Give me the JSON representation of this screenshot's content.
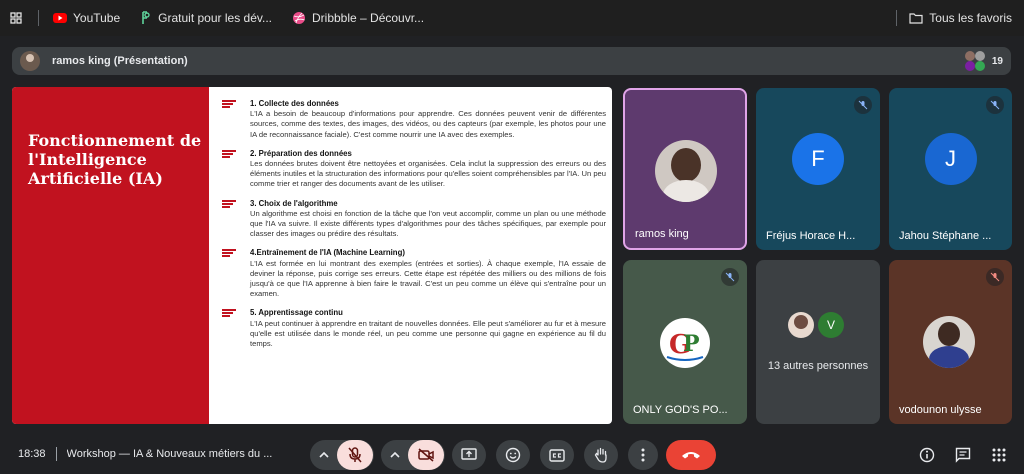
{
  "bookmarks": {
    "items": [
      {
        "label": "YouTube",
        "icon": "youtube-icon"
      },
      {
        "label": "Gratuit pour les dév...",
        "icon": "figma-icon"
      },
      {
        "label": "Dribbble – Découvr...",
        "icon": "dribbble-icon"
      }
    ],
    "all_favorites": "Tous les favoris"
  },
  "presentation_bar": {
    "label": "ramos king (Présentation)",
    "participant_count": "19"
  },
  "slide": {
    "title": "Fonctionnement de l'Intelligence Artificielle (IA)",
    "sections": [
      {
        "title": "1. Collecte des données",
        "body": "L'IA a besoin de beaucoup d'informations pour apprendre. Ces données peuvent venir de différentes sources, comme des textes, des images, des vidéos, ou des capteurs (par exemple, les photos pour une IA de reconnaissance faciale). C'est comme nourrir une IA avec des exemples."
      },
      {
        "title": "2. Préparation des données",
        "body": "Les données brutes doivent être nettoyées et organisées. Cela inclut la suppression des erreurs ou des éléments inutiles et la structuration des informations pour qu'elles soient compréhensibles par l'IA. Un peu comme trier et ranger des documents avant de les utiliser."
      },
      {
        "title": "3. Choix de l'algorithme",
        "body": "Un algorithme est choisi en fonction de la tâche que l'on veut accomplir, comme un plan ou une méthode que l'IA va suivre. Il existe différents types d'algorithmes pour des tâches spécifiques, par exemple pour classer des images ou prédire des résultats."
      },
      {
        "title": "4.Entraînement de l'IA (Machine Learning)",
        "body": "L'IA est formée en lui montrant des exemples (entrées et sorties). À chaque exemple, l'IA essaie de deviner la réponse, puis corrige ses erreurs. Cette étape est répétée des milliers ou des millions de fois jusqu'à ce que l'IA apprenne à bien faire le travail. C'est un peu comme un élève qui s'entraîne pour un examen."
      },
      {
        "title": "5. Apprentissage continu",
        "body": "L'IA peut continuer à apprendre en traitant de nouvelles données. Elle peut s'améliorer au fur et à mesure qu'elle est utilisée dans le monde réel, un peu comme une personne qui gagne en expérience au fil du temps."
      }
    ]
  },
  "participants": [
    {
      "name": "ramos king",
      "type": "photo",
      "muted": false,
      "active": true
    },
    {
      "name": "Fréjus Horace H...",
      "letter": "F",
      "muted": true
    },
    {
      "name": "Jahou Stéphane ...",
      "letter": "J",
      "muted": true
    },
    {
      "name": "ONLY GOD'S PO...",
      "type": "logo",
      "muted": true
    },
    {
      "name": "13 autres personnes",
      "letter": "V",
      "type": "others"
    },
    {
      "name": "vodounon ulysse",
      "type": "photo",
      "muted": true
    }
  ],
  "bottom_bar": {
    "time": "18:38",
    "meeting_title": "Workshop — IA & Nouveaux métiers du ..."
  },
  "colors": {
    "slide_red": "#c1121f",
    "active_border": "#e0a4e8",
    "end_call": "#ea4335",
    "muted_control": "#f9dedc"
  }
}
